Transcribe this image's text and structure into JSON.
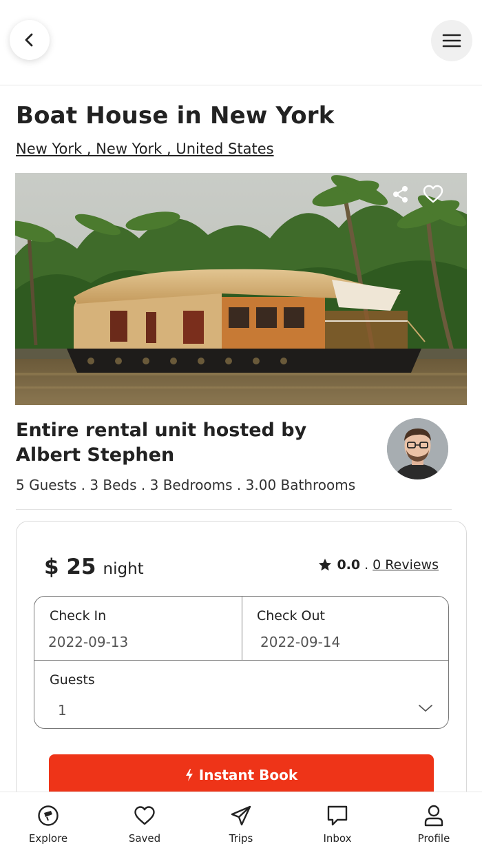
{
  "header": {
    "back_icon": "chevron-left-icon",
    "menu_icon": "hamburger-menu-icon"
  },
  "listing": {
    "title": "Boat House in New York",
    "location": "New York , New York , United States",
    "image_description_icons": [
      "share-icon",
      "heart-icon"
    ],
    "host_title": "Entire rental unit hosted by Albert Stephen",
    "specs": "5 Guests . 3 Beds . 3 Bedrooms . 3.00 Bathrooms"
  },
  "booking": {
    "price_amount": "$ 25",
    "price_unit": "night",
    "rating_value": "0.0",
    "rating_separator": ".",
    "reviews_label": "0 Reviews",
    "check_in_label": "Check In",
    "check_in_value": "2022-09-13",
    "check_out_label": "Check Out",
    "check_out_value": "2022-09-14",
    "guests_label": "Guests",
    "guests_value": "1",
    "book_button_label": "Instant Book",
    "accent_color": "#ee3418"
  },
  "bottom_nav": {
    "items": [
      {
        "label": "Explore",
        "icon": "compass-icon"
      },
      {
        "label": "Saved",
        "icon": "heart-icon"
      },
      {
        "label": "Trips",
        "icon": "paper-plane-icon"
      },
      {
        "label": "Inbox",
        "icon": "chat-bubble-icon"
      },
      {
        "label": "Profile",
        "icon": "user-icon"
      }
    ]
  }
}
